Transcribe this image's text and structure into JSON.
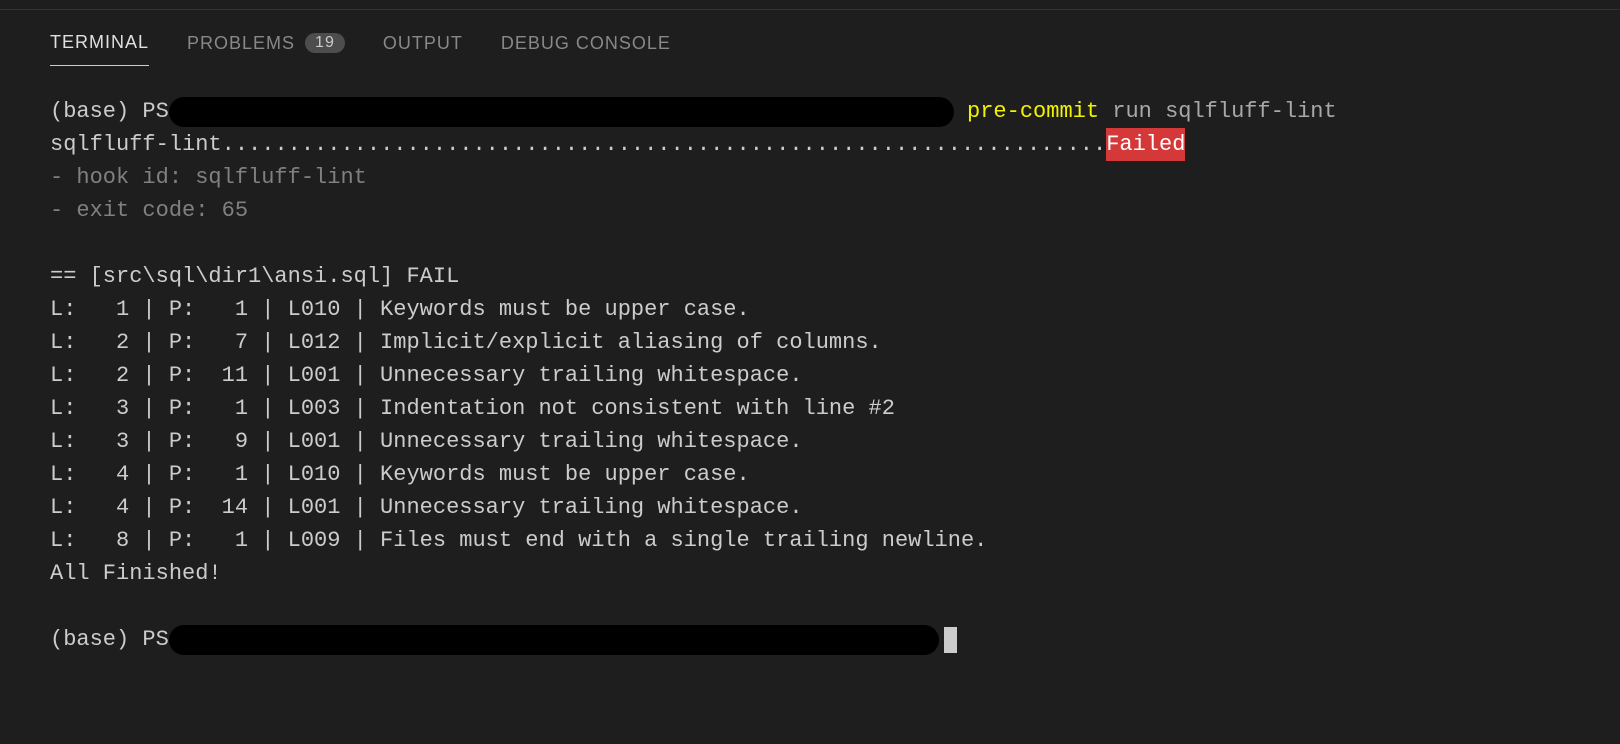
{
  "tabs": {
    "terminal": "TERMINAL",
    "problems": "PROBLEMS",
    "problems_count": "19",
    "output": "OUTPUT",
    "debug_console": "DEBUG CONSOLE"
  },
  "terminal": {
    "prompt1_prefix": "(base) PS",
    "cmd_part1": " pre-commit",
    "cmd_part2": " run",
    "cmd_part3": " sqlfluff-lint",
    "status_name": "sqlfluff-lint",
    "status_dots": "...................................................................",
    "status_result": "Failed",
    "hook_id": "- hook id: sqlfluff-lint",
    "exit_code": "- exit code: 65",
    "file_header": "== [src\\sql\\dir1\\ansi.sql] FAIL",
    "lines": [
      "L:   1 | P:   1 | L010 | Keywords must be upper case.",
      "L:   2 | P:   7 | L012 | Implicit/explicit aliasing of columns.",
      "L:   2 | P:  11 | L001 | Unnecessary trailing whitespace.",
      "L:   3 | P:   1 | L003 | Indentation not consistent with line #2",
      "L:   3 | P:   9 | L001 | Unnecessary trailing whitespace.",
      "L:   4 | P:   1 | L010 | Keywords must be upper case.",
      "L:   4 | P:  14 | L001 | Unnecessary trailing whitespace.",
      "L:   8 | P:   1 | L009 | Files must end with a single trailing newline."
    ],
    "finished": "All Finished!",
    "prompt2_prefix": "(base) PS"
  }
}
